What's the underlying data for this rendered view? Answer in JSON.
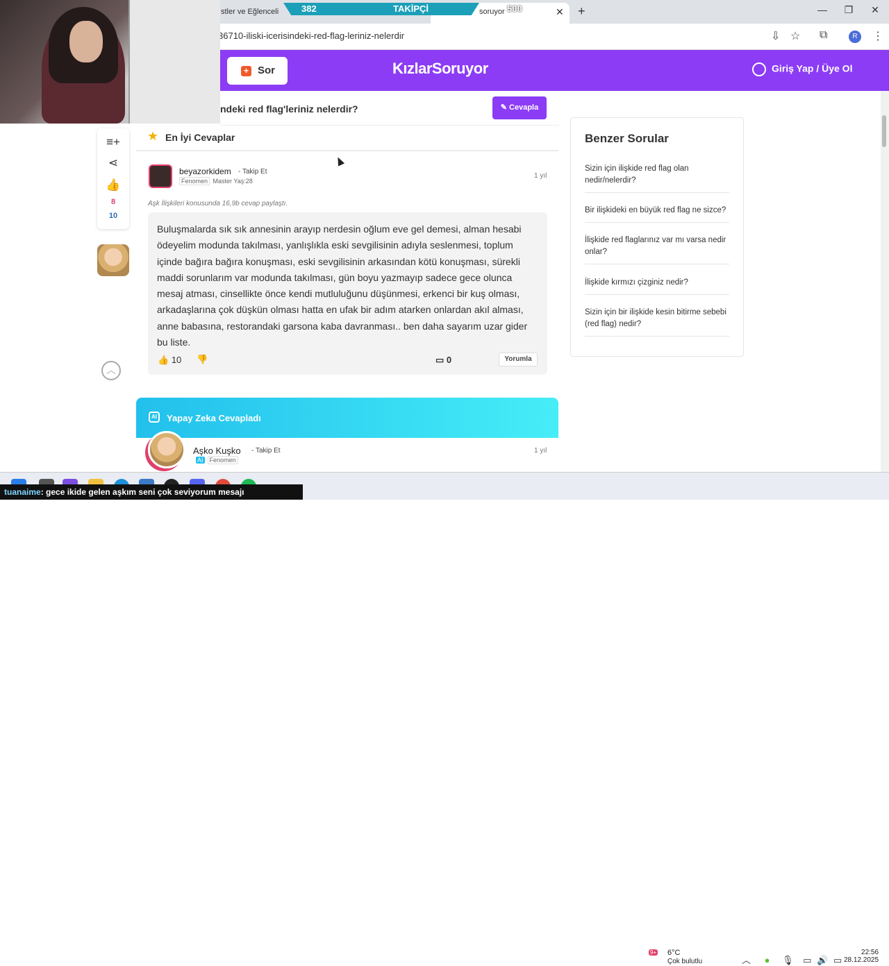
{
  "browser": {
    "tab1_title": "stler ve Eğlenceli",
    "tab2_title": "soruyor",
    "url": "36710-iliski-icerisindeki-red-flag-leriniz-nelerdir",
    "profile_initial": "R"
  },
  "overlay": {
    "followers_current": "382",
    "followers_label": "TAKİPÇİ",
    "followers_goal": "500"
  },
  "site": {
    "ask_label": "Sor",
    "logo": "KızlarSoruyor",
    "login_label": "Giriş Yap / Üye Ol",
    "question_title": "ndeki red flag'leriniz nelerdir?",
    "answer_button": "Cevapla"
  },
  "actions": {
    "likes": "8",
    "score": "10"
  },
  "best_answers": {
    "heading": "En İyi Cevaplar",
    "answer": {
      "username": "beyazorkidem",
      "follow_label": "Takip Et",
      "badge": "Fenomen",
      "level": "Master Yaş:28",
      "time": "1 yıl",
      "meta": "Aşk İlişkileri konusunda 16,9b cevap paylaştı.",
      "text": "Buluşmalarda sık sık annesinin arayıp nerdesin oğlum eve gel demesi, alman hesabi ödeyelim modunda takılması, yanlışlıkla eski sevgilisinin adıyla seslenmesi, toplum içinde bağıra bağıra konuşması, eski sevgilisinin arkasından kötü konuşması, sürekli maddi sorunlarım var modunda takılması, gün boyu yazmayıp sadece gece olunca mesaj atması, cinsellikte önce kendi mutluluğunu düşünmesi, erkenci bir kuş olması, arkadaşlarına çok düşkün olması hatta en ufak bir adım atarken onlardan akıl alması, anne babasına, restorandaki garsona kaba davranması.. ben daha sayarım uzar gider bu liste.",
      "likes": "10",
      "comments": "0",
      "comment_button": "Yorumla"
    }
  },
  "ai_answer": {
    "heading": "Yapay Zeka Cevapladı",
    "icon_text": "AI",
    "username": "Aşko Kuşko",
    "follow_label": "Takip Et",
    "badge": "Fenomen",
    "time": "1 yıl"
  },
  "similar": {
    "heading": "Benzer Sorular",
    "items": [
      "Sizin için ilişkide red flag olan nedir/nelerdir?",
      "Bir ilişkideki en büyük red flag ne sizce?",
      "İlişkide red flaglarınız var mı varsa nedir onlar?",
      "İlişkide kırmızı çizginiz nedir?",
      "Sizin için bir ilişkide kesin bitirme sebebi (red flag) nedir?"
    ]
  },
  "taskbar": {
    "chat_user": "tuanaime",
    "chat_message": ": gece ikide gelen aşkım seni çok seviyorum mesajı",
    "weather_temp": "6°C",
    "weather_desc": "Çok bulutlu",
    "weather_badge": "9+",
    "time": "22:56",
    "date": "28.12.2025"
  },
  "colors": {
    "brand_purple": "#8c3cf5",
    "ai_cyan": "#22c0ec",
    "like_pink": "#e0406a"
  }
}
